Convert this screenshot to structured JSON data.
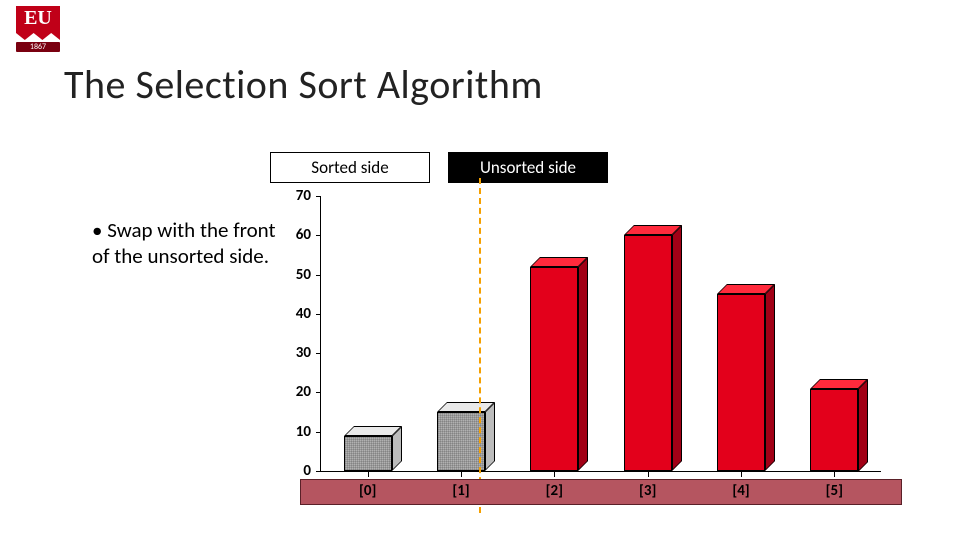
{
  "logo": {
    "text": "EU",
    "year": "1867"
  },
  "title": "The Selection Sort Algorithm",
  "labels": {
    "sorted": "Sorted side",
    "unsorted": "Unsorted side"
  },
  "bullet": "Swap with the front of the unsorted side.",
  "chart_data": {
    "type": "bar",
    "title": "",
    "xlabel": "",
    "ylabel": "",
    "ylim": [
      0,
      70
    ],
    "yticks": [
      0,
      10,
      20,
      30,
      40,
      50,
      60,
      70
    ],
    "categories": [
      "[0]",
      "[1]",
      "[2]",
      "[3]",
      "[4]",
      "[5]"
    ],
    "values": [
      9,
      15,
      52,
      60,
      45,
      21
    ],
    "sorted_count": 2,
    "colors": {
      "sorted": "#d9d9d9",
      "unsorted": "#e3001b"
    }
  }
}
